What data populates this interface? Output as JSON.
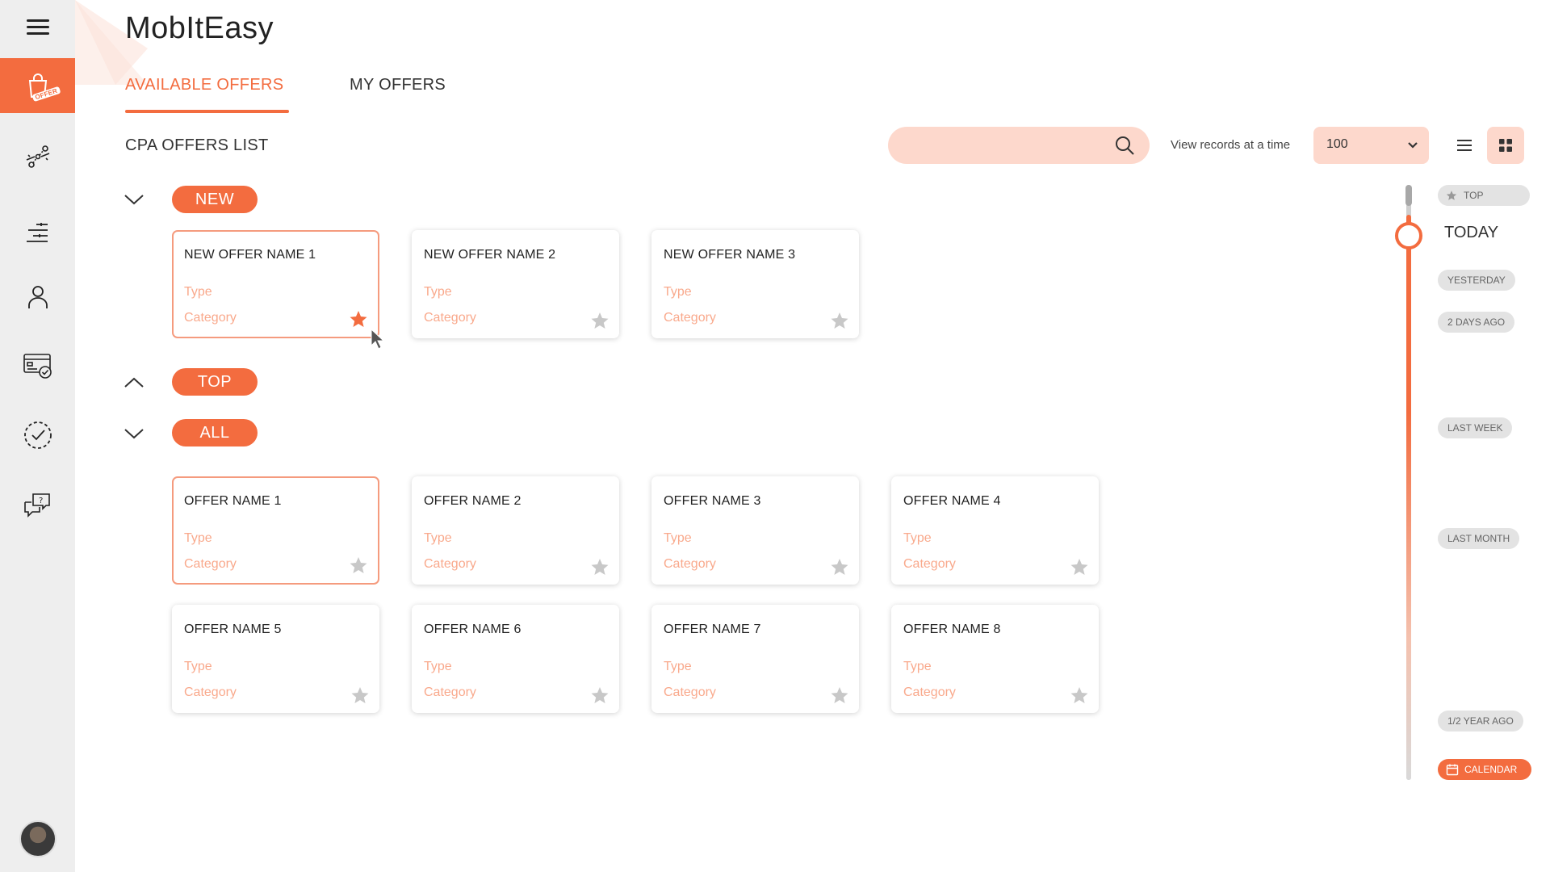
{
  "app": {
    "title": "MobItEasy"
  },
  "sidebar": {
    "items": [
      {
        "name": "offers",
        "icon": "shopping-bag-icon",
        "badge": "OFFER",
        "active": true
      },
      {
        "name": "integrations",
        "icon": "node-chain-icon",
        "active": false
      },
      {
        "name": "reports",
        "icon": "list-bars-icon",
        "active": false
      },
      {
        "name": "profile",
        "icon": "user-icon",
        "active": false
      },
      {
        "name": "payments",
        "icon": "card-check-icon",
        "active": false
      },
      {
        "name": "tasks",
        "icon": "dashed-check-icon",
        "active": false
      },
      {
        "name": "support",
        "icon": "chat-question-icon",
        "active": false
      }
    ]
  },
  "tabs": [
    {
      "label": "AVAILABLE OFFERS",
      "active": true
    },
    {
      "label": "MY OFFERS",
      "active": false
    }
  ],
  "toolbar": {
    "list_title": "CPA OFFERS LIST",
    "search_value": "",
    "view_label": "View  records at a time",
    "records_value": "100"
  },
  "sections": {
    "new": {
      "label": "NEW",
      "expanded": true
    },
    "top": {
      "label": "TOP",
      "expanded": false
    },
    "all": {
      "label": "ALL",
      "expanded": true
    }
  },
  "new_offers": [
    {
      "name": "NEW OFFER NAME 1",
      "type": "Type",
      "category": "Category",
      "favorite": true
    },
    {
      "name": "NEW OFFER NAME 2",
      "type": "Type",
      "category": "Category",
      "favorite": false
    },
    {
      "name": "NEW OFFER NAME 3",
      "type": "Type",
      "category": "Category",
      "favorite": false
    }
  ],
  "all_offers": [
    {
      "name": "OFFER NAME 1",
      "type": "Type",
      "category": "Category",
      "favorite": false
    },
    {
      "name": "OFFER NAME 2",
      "type": "Type",
      "category": "Category",
      "favorite": false
    },
    {
      "name": "OFFER NAME 3",
      "type": "Type",
      "category": "Category",
      "favorite": false
    },
    {
      "name": "OFFER NAME 4",
      "type": "Type",
      "category": "Category",
      "favorite": false
    },
    {
      "name": "OFFER NAME 5",
      "type": "Type",
      "category": "Category",
      "favorite": false
    },
    {
      "name": "OFFER NAME 6",
      "type": "Type",
      "category": "Category",
      "favorite": false
    },
    {
      "name": "OFFER NAME 7",
      "type": "Type",
      "category": "Category",
      "favorite": false
    },
    {
      "name": "OFFER NAME 8",
      "type": "Type",
      "category": "Category",
      "favorite": false
    }
  ],
  "timeline": {
    "top": "TOP",
    "today": "TODAY",
    "yesterday": "YESTERDAY",
    "two_days": "2 DAYS AGO",
    "last_week": "LAST WEEK",
    "last_month": "LAST MONTH",
    "half_year": "1/2 YEAR AGO",
    "calendar": "CALENDAR"
  },
  "colors": {
    "accent": "#f36c3f",
    "accent_light": "#fdd8cc",
    "muted_text": "#f9a98c",
    "star_inactive": "#c8c8c8"
  }
}
